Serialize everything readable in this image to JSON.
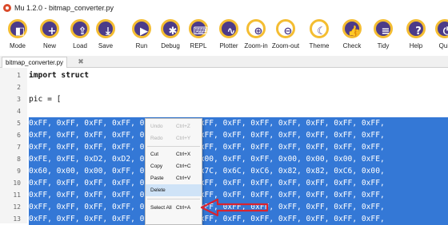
{
  "window": {
    "title": "Mu 1.2.0 - bitmap_converter.py"
  },
  "toolbar": [
    {
      "name": "mode",
      "label": "Mode",
      "icon": "◧",
      "light": false
    },
    {
      "name": "new",
      "label": "New",
      "icon": "+",
      "light": false
    },
    {
      "name": "load",
      "label": "Load",
      "icon": "⇪",
      "light": false
    },
    {
      "name": "save",
      "label": "Save",
      "icon": "⤓",
      "light": false
    },
    {
      "name": "run",
      "label": "Run",
      "icon": "▶",
      "light": false
    },
    {
      "name": "debug",
      "label": "Debug",
      "icon": "✱",
      "light": false
    },
    {
      "name": "repl",
      "label": "REPL",
      "icon": "⌨",
      "light": false
    },
    {
      "name": "plotter",
      "label": "Plotter",
      "icon": "∿",
      "light": false
    },
    {
      "name": "zoom-in",
      "label": "Zoom-in",
      "icon": "⊕",
      "light": true
    },
    {
      "name": "zoom-out",
      "label": "Zoom-out",
      "icon": "⊖",
      "light": true
    },
    {
      "name": "theme",
      "label": "Theme",
      "icon": "☾",
      "light": true
    },
    {
      "name": "check",
      "label": "Check",
      "icon": "👍",
      "light": false
    },
    {
      "name": "tidy",
      "label": "Tidy",
      "icon": "≡",
      "light": false
    },
    {
      "name": "help",
      "label": "Help",
      "icon": "?",
      "light": false
    },
    {
      "name": "quit",
      "label": "Quit",
      "icon": "⏻",
      "light": false
    }
  ],
  "tabs": [
    {
      "label": "bitmap_converter.py",
      "close": "✖"
    }
  ],
  "editor": {
    "lines": [
      {
        "num": "1",
        "text": "import struct",
        "kw": true,
        "selected": false
      },
      {
        "num": "2",
        "text": "",
        "selected": false
      },
      {
        "num": "3",
        "text": "pic = [",
        "selected": false
      },
      {
        "num": "4",
        "text": "",
        "selected": false
      },
      {
        "num": "5",
        "text": "0xFF, 0xFF, 0xFF, 0xFF, 0xFF, 0xFF, 0xFF, 0xFF, 0xFF, 0xFF, 0xFF, 0xFF, 0xFF,",
        "selected": true
      },
      {
        "num": "6",
        "text": "0xFF, 0xFF, 0xFF, 0xFF, 0xFF, 0xFF, 0xFF, 0xFF, 0xFF, 0xFF, 0xFF, 0xFF, 0xFF,",
        "selected": true
      },
      {
        "num": "7",
        "text": "0xFF, 0xFF, 0xFF, 0xFF, 0xFF, 0xFF, 0xFF, 0xFF, 0xFF, 0xFF, 0xFF, 0xFF, 0xFF,",
        "selected": true
      },
      {
        "num": "8",
        "text": "0xFE, 0xFE, 0xD2, 0xD2, 0x60, 0x00, 0x00, 0xFF, 0xFF, 0x00, 0x00, 0x00, 0xFE,",
        "selected": true
      },
      {
        "num": "9",
        "text": "0x60, 0x00, 0x00, 0xFF, 0x60, 0x00, 0x7C, 0x6C, 0xC6, 0x82, 0x82, 0xC6, 0x00,",
        "selected": true
      },
      {
        "num": "10",
        "text": "0xFF, 0xFF, 0xFF, 0xFF, 0xFF, 0xFF, 0xFF, 0xFF, 0xFF, 0xFF, 0xFF, 0xFF, 0xFF,",
        "selected": true
      },
      {
        "num": "11",
        "text": "0xFF, 0xFF, 0xFF, 0xFF, 0xFF, 0xFF, 0xFF, 0xFF, 0xFF, 0xFF, 0xFF, 0xFF, 0xFF,",
        "selected": true
      },
      {
        "num": "12",
        "text": "0xFF, 0xFF, 0xFF, 0xFF, 0xFF, 0xFF, 0xFF, 0xFF, 0xFF, 0xFF, 0xFF, 0xFF, 0xFF,",
        "selected": true
      },
      {
        "num": "13",
        "text": "0xFF, 0xFF, 0xFF, 0xFF, 0xFF, 0xFF, 0xFF, 0xFF, 0xFF, 0xFF, 0xFF, 0xFF, 0xFF,",
        "selected": true
      }
    ]
  },
  "context_menu": {
    "undo": {
      "label": "Undo",
      "key": "Ctrl+Z"
    },
    "redo": {
      "label": "Redo",
      "key": "Ctrl+Y"
    },
    "cut": {
      "label": "Cut",
      "key": "Ctrl+X"
    },
    "copy": {
      "label": "Copy",
      "key": "Ctrl+C"
    },
    "paste": {
      "label": "Paste",
      "key": "Ctrl+V"
    },
    "delete": {
      "label": "Delete"
    },
    "select_all": {
      "label": "Select All",
      "key": "Ctrl+A"
    }
  },
  "colors": {
    "selection": "#3478d6",
    "toolbar_fill": "#4c3b89",
    "toolbar_ring": "#f4bd32",
    "arrow": "#d9232f"
  }
}
